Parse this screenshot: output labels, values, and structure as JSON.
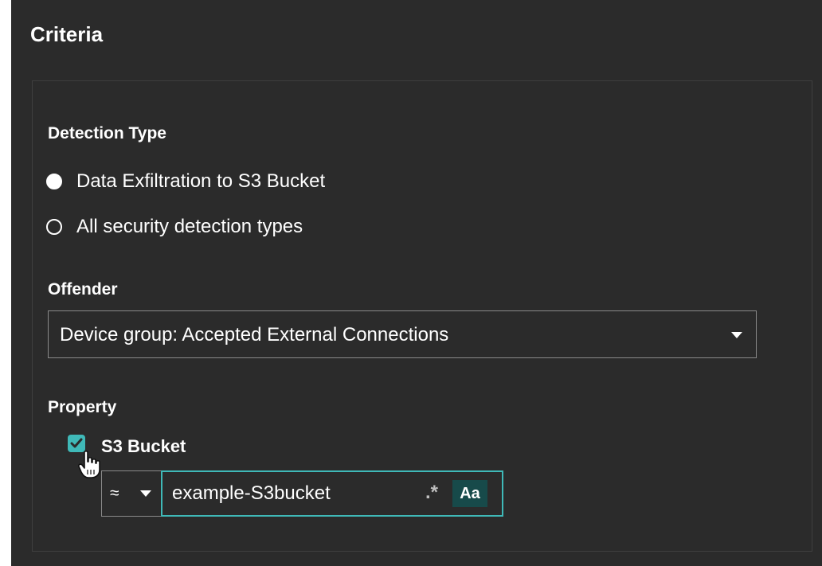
{
  "panel": {
    "title": "Criteria"
  },
  "detection_type": {
    "label": "Detection Type",
    "options": [
      {
        "label": "Data Exfiltration to S3 Bucket",
        "selected": true
      },
      {
        "label": "All security detection types",
        "selected": false
      }
    ]
  },
  "offender": {
    "label": "Offender",
    "selected_value": "Device group: Accepted External Connections",
    "icon": "triangle-down-icon"
  },
  "property": {
    "label": "Property",
    "checkbox": {
      "label": "S3 Bucket",
      "checked": true
    },
    "operator": {
      "symbol": "≈",
      "icon": "triangle-down-icon"
    },
    "input": {
      "value": "example-S3bucket"
    },
    "regex_toggle": ".*",
    "case_toggle": "Aa"
  },
  "colors": {
    "panel_bg": "#2b2b2b",
    "border": "#8a8a8a",
    "accent": "#3fb9b8",
    "case_toggle_bg": "#174a4a",
    "text": "#ffffff"
  }
}
